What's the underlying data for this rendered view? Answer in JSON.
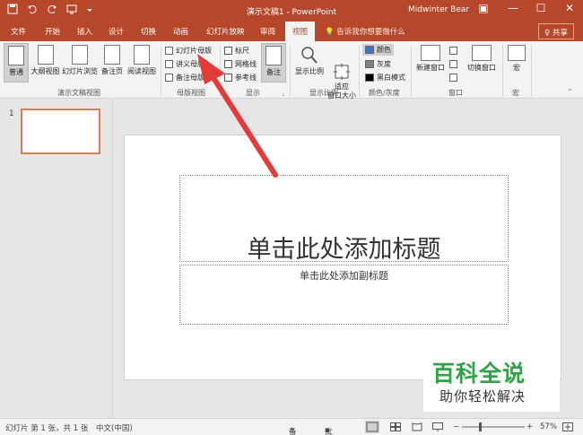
{
  "titlebar": {
    "doc_title": "演示文稿1 - PowerPoint",
    "user": "Midwinter Bear",
    "save_icon": "save-icon",
    "undo_icon": "undo-icon",
    "redo_icon": "redo-icon",
    "ribbon_display_glyph": "▣",
    "minimize_glyph": "—",
    "maximize_glyph": "☐",
    "close_glyph": "✕"
  },
  "tabs": [
    "文件",
    "开始",
    "插入",
    "设计",
    "切换",
    "动画",
    "幻灯片放映",
    "审阅",
    "视图"
  ],
  "active_tab": "视图",
  "tell_me": "告诉我你想要做什么",
  "share": "共享",
  "ribbon": {
    "presentation_views": {
      "label": "演示文稿视图",
      "buttons": [
        "普通",
        "大纲视图",
        "幻灯片浏览",
        "备注页",
        "阅读视图"
      ]
    },
    "master_views": {
      "label": "母版视图",
      "buttons": [
        "幻灯片母版",
        "讲义母版",
        "备注母版"
      ]
    },
    "show": {
      "label": "显示",
      "checkboxes": [
        "标尺",
        "网格线",
        "参考线"
      ],
      "notes_button": "备注"
    },
    "zoom": {
      "label": "显示比例",
      "buttons": [
        "显示比例",
        "适应\n窗口大小"
      ]
    },
    "color": {
      "label": "颜色/灰度",
      "options": [
        "颜色",
        "灰度",
        "黑白模式"
      ],
      "colors": [
        "#4472c4",
        "#7f7f7f",
        "#000000"
      ]
    },
    "window": {
      "label": "窗口",
      "buttons": [
        "新建窗口",
        "切换窗口"
      ]
    },
    "macros": {
      "label": "宏",
      "button": "宏"
    }
  },
  "thumbnails": [
    {
      "number": "1"
    }
  ],
  "slide": {
    "title_placeholder": "单击此处添加标题",
    "subtitle_placeholder": "单击此处添加副标题"
  },
  "watermark": {
    "line1": "百科全说",
    "line2": "助你轻松解决"
  },
  "statusbar": {
    "slide_info": "幻灯片 第 1 张，共 1 张",
    "language": "中文(中国)",
    "notes": "备注",
    "comments": "批注",
    "zoom": "57%"
  },
  "colors": {
    "accent": "#b7472a",
    "arrow": "#e53a3a",
    "watermark_green": "#2ea446"
  }
}
